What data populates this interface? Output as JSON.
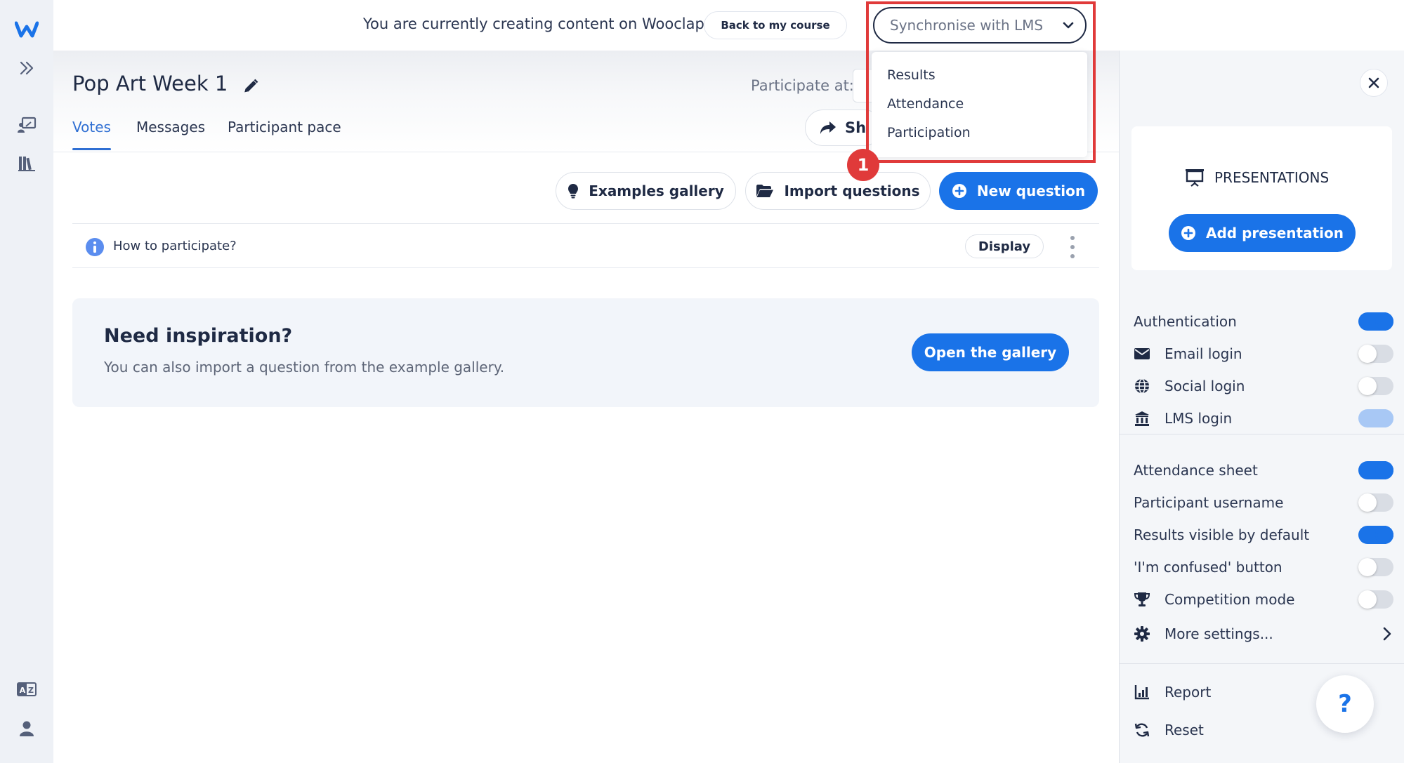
{
  "app": {
    "logo_letter": "w",
    "brand_color": "#1a73e8",
    "highlight_color": "#e03a3a"
  },
  "banner": {
    "message": "You are currently creating content on Wooclap.",
    "back_button": "Back to my course"
  },
  "lms": {
    "select_value": "Synchronise with LMS",
    "options": [
      "Results",
      "Attendance",
      "Participation"
    ],
    "step_number": "1"
  },
  "header": {
    "title": "Pop Art Week 1",
    "participate_label": "Participate at:",
    "share_label": "Sh",
    "tabs": [
      {
        "label": "Votes",
        "active": true
      },
      {
        "label": "Messages",
        "active": false
      },
      {
        "label": "Participant pace",
        "active": false
      }
    ]
  },
  "toolbar": {
    "examples_gallery": "Examples gallery",
    "import_questions": "Import questions",
    "new_question": "New question"
  },
  "question_row": {
    "text": "How to participate?",
    "display_button": "Display"
  },
  "inspiration": {
    "title": "Need inspiration?",
    "subtitle": "You can also import a question from the example gallery.",
    "button": "Open the gallery"
  },
  "panel": {
    "presentations_title": "PRESENTATIONS",
    "add_presentation": "Add presentation",
    "settings": [
      {
        "label": "Authentication",
        "icon": "none",
        "on": true
      },
      {
        "label": "Email login",
        "icon": "envelope-icon",
        "on": false
      },
      {
        "label": "Social login",
        "icon": "globe-icon",
        "on": false
      },
      {
        "label": "LMS login",
        "icon": "institution-icon",
        "on": true,
        "muted": true
      },
      {
        "label": "Attendance sheet",
        "icon": "none",
        "on": true
      },
      {
        "label": "Participant username",
        "icon": "none",
        "on": false
      },
      {
        "label": "Results visible by default",
        "icon": "none",
        "on": true
      },
      {
        "label": "'I'm confused' button",
        "icon": "none",
        "on": false
      },
      {
        "label": "Competition mode",
        "icon": "trophy-icon",
        "on": false
      }
    ],
    "more_settings": "More settings...",
    "report": "Report",
    "reset": "Reset",
    "help": "?"
  }
}
